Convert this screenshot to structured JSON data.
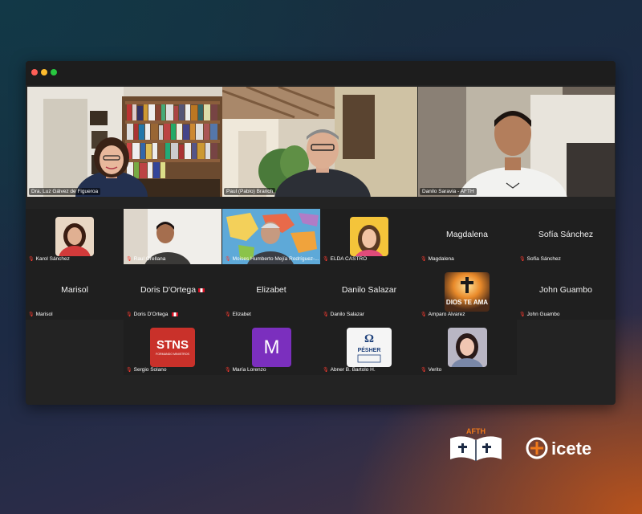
{
  "meeting": {
    "featured": [
      {
        "name": "Dra. Luz Gálvez de Figueroa"
      },
      {
        "name": "Paul (Pablo) Branch"
      },
      {
        "name": "Danilo Saravia - AFTH"
      }
    ],
    "grid": [
      {
        "label": "Karol Sánchez",
        "display_name": ""
      },
      {
        "label": "Raul Orellana",
        "display_name": ""
      },
      {
        "label": "Moises Humberto Mejía Rodríguez-...",
        "display_name": ""
      },
      {
        "label": "ELDA CASTRO",
        "display_name": ""
      },
      {
        "label": "Magdalena",
        "display_name": "Magdalena"
      },
      {
        "label": "Sofía Sánchez",
        "display_name": "Sofía Sánchez"
      },
      {
        "label": "Marisol",
        "display_name": "Marisol"
      },
      {
        "label": "Doris D'Ortega",
        "display_name": "Doris D'Ortega"
      },
      {
        "label": "Elizabet",
        "display_name": "Elizabet"
      },
      {
        "label": "Danilo Salazar",
        "display_name": "Danilo Salazar"
      },
      {
        "label": "Amparo Alvarez",
        "display_name": ""
      },
      {
        "label": "John Guambo",
        "display_name": "John Guambo"
      },
      {
        "label": "Sergio Solano",
        "display_name": ""
      },
      {
        "label": "María Lorenzo",
        "display_name": ""
      },
      {
        "label": "Abner B. Bartolo H.",
        "display_name": ""
      },
      {
        "label": "Verito",
        "display_name": ""
      }
    ],
    "avatars": {
      "sergio": {
        "big": "STNS",
        "small": "FORMANDO MINISTROS"
      },
      "maria": {
        "initial": "M",
        "color": "#7b2fbe"
      },
      "abner": {
        "big": "PÉSHER"
      },
      "amparo": {
        "text": "DIOS TE AMA"
      }
    }
  },
  "branding": {
    "afth": "AFTH",
    "icete": "icete"
  },
  "colors": {
    "accent_active": "#3fae53",
    "mic_off": "#ff3b30",
    "orange": "#f07a1c"
  }
}
